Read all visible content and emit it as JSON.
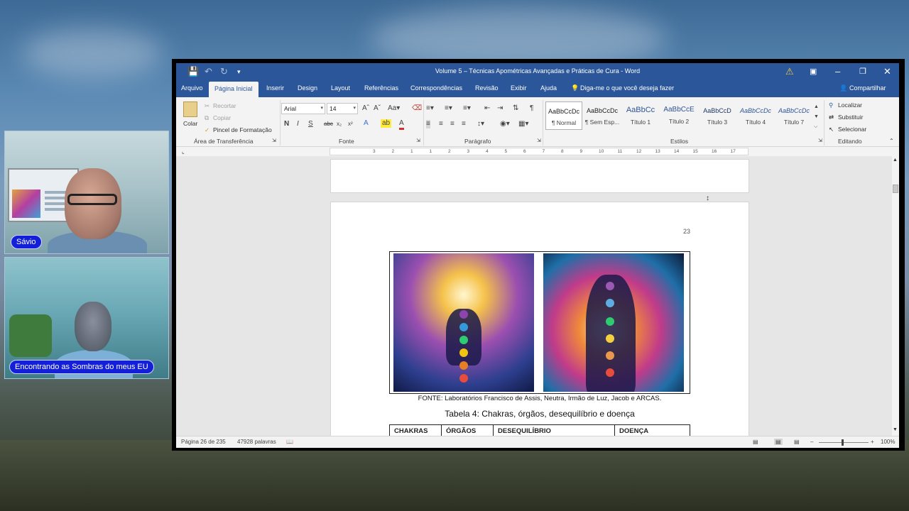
{
  "participants": [
    {
      "name": "Sávio"
    },
    {
      "name": "Encontrando as Sombras do meus EU"
    }
  ],
  "word": {
    "title": "Volume 5 – Técnicas Apométricas Avançadas e Práticas de Cura  -  Word",
    "tabs": [
      "Arquivo",
      "Página Inicial",
      "Inserir",
      "Design",
      "Layout",
      "Referências",
      "Correspondências",
      "Revisão",
      "Exibir",
      "Ajuda"
    ],
    "tell_me": "Diga-me o que você deseja fazer",
    "share": "Compartilhar",
    "clipboard": {
      "paste": "Colar",
      "cut": "Recortar",
      "copy": "Copiar",
      "format_painter": "Pincel de Formatação",
      "label": "Área de Transferência"
    },
    "font": {
      "name": "Arial",
      "size": "14",
      "label": "Fonte"
    },
    "paragraph_label": "Parágrafo",
    "styles": {
      "label": "Estilos",
      "items": [
        {
          "sample": "AaBbCcDc",
          "name": "¶ Normal"
        },
        {
          "sample": "AaBbCcDc",
          "name": "¶ Sem Esp..."
        },
        {
          "sample": "AaBbCc",
          "name": "Título 1"
        },
        {
          "sample": "AaBbCcE",
          "name": "Título 2"
        },
        {
          "sample": "AaBbCcD",
          "name": "Título 3"
        },
        {
          "sample": "AaBbCcDc",
          "name": "Título 4"
        },
        {
          "sample": "AaBbCcDc",
          "name": "Título 7"
        }
      ]
    },
    "editing": {
      "find": "Localizar",
      "replace": "Substituir",
      "select": "Selecionar",
      "label": "Editando"
    },
    "ruler": [
      "3",
      "2",
      "1",
      "1",
      "2",
      "3",
      "4",
      "5",
      "6",
      "7",
      "8",
      "9",
      "10",
      "11",
      "12",
      "13",
      "14",
      "15",
      "16",
      "17"
    ],
    "document": {
      "page_number": "23",
      "caption": "FONTE: Laboratórios Francisco de Assis, Neutra, Irmão de Luz, Jacob e ARCAS.",
      "table_title": "Tabela 4: Chakras, órgãos, desequilíbrio e doença",
      "table_headers": [
        "CHAKRAS",
        "ÓRGÃOS",
        "DESEQUILÍBRIO",
        "DOENÇA"
      ]
    },
    "status": {
      "page": "Página 26 de 235",
      "words": "47928 palavras",
      "zoom": "100%"
    }
  }
}
